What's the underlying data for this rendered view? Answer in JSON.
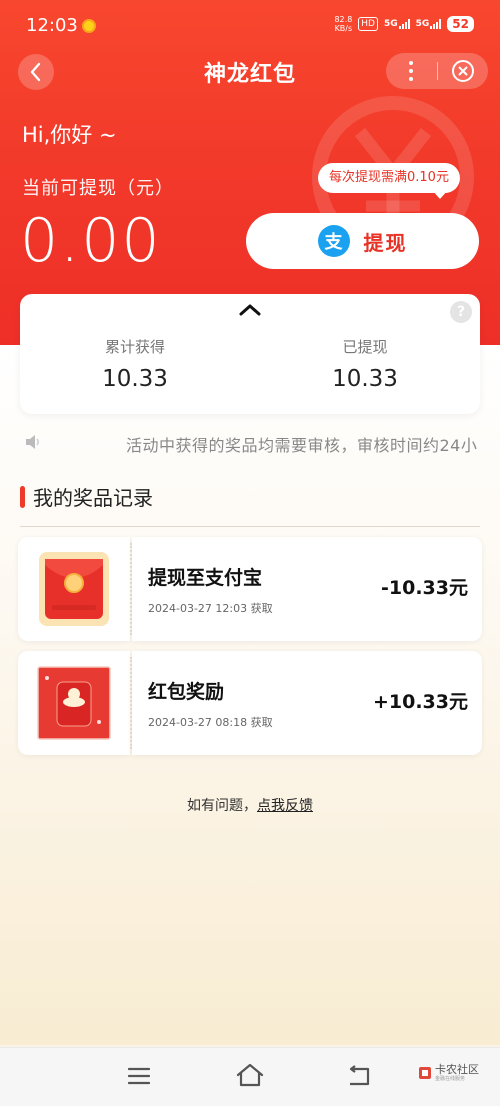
{
  "status_bar": {
    "time": "12:03",
    "net_speed": "82.8",
    "net_unit": "KB/s",
    "hd_label": "HD",
    "sim1": "5G",
    "sim2": "5G",
    "battery": "52"
  },
  "nav": {
    "title": "神龙红包"
  },
  "account": {
    "greeting": "Hi,你好 ~",
    "balance_label": "当前可提现（元）",
    "balance": "0.00",
    "tip": "每次提现需满0.10元",
    "withdraw_label": "提现",
    "alipay_glyph": "支"
  },
  "summary": {
    "earned_label": "累计获得",
    "earned_value": "10.33",
    "withdrawn_label": "已提现",
    "withdrawn_value": "10.33",
    "help_glyph": "?"
  },
  "notice": {
    "text": "活动中获得的奖品均需要审核，审核时间约24小"
  },
  "records_section": {
    "title": "我的奖品记录",
    "items": [
      {
        "title": "提现至支付宝",
        "time": "2024-03-27 12:03 获取",
        "amount": "-10.33元"
      },
      {
        "title": "红包奖励",
        "time": "2024-03-27 08:18 获取",
        "amount": "+10.33元"
      }
    ]
  },
  "feedback": {
    "prefix": "如有问题，",
    "link": "点我反馈"
  },
  "watermark": {
    "name": "卡农社区",
    "sub": "金融在线服务"
  },
  "colors": {
    "header_red": "#f23a2a",
    "accent_red": "#e73225",
    "alipay_blue": "#1aa1f0"
  },
  "icons": [
    "back-icon",
    "more-icon",
    "close-icon",
    "yen-icon",
    "alipay-icon",
    "chevron-up-icon",
    "help-icon",
    "speaker-icon",
    "menu-icon",
    "home-icon",
    "return-icon"
  ]
}
